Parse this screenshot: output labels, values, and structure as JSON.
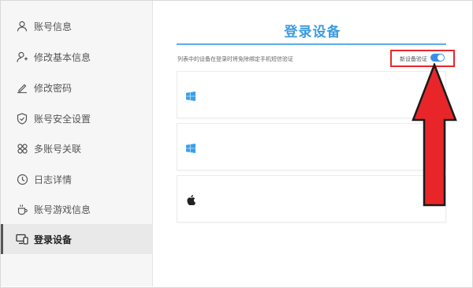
{
  "sidebar": {
    "items": [
      {
        "label": "账号信息",
        "icon": "user-icon"
      },
      {
        "label": "修改基本信息",
        "icon": "user-edit-icon"
      },
      {
        "label": "修改密码",
        "icon": "pencil-icon"
      },
      {
        "label": "账号安全设置",
        "icon": "shield-icon"
      },
      {
        "label": "多账号关联",
        "icon": "linked-accounts-icon"
      },
      {
        "label": "日志详情",
        "icon": "clock-icon"
      },
      {
        "label": "账号游戏信息",
        "icon": "cup-icon"
      },
      {
        "label": "登录设备",
        "icon": "devices-icon"
      }
    ],
    "active_index": 7
  },
  "main": {
    "title": "登录设备",
    "hint": "列表中的设备在登录时将免除绑定手机短信验证",
    "new_device_verify": {
      "label": "新设备验证",
      "enabled": true
    },
    "devices": [
      {
        "icon": "windows-icon"
      },
      {
        "icon": "windows-icon"
      },
      {
        "icon": "apple-icon"
      }
    ]
  },
  "colors": {
    "accent": "#3d9ce0",
    "toggle_on": "#3a8ee6",
    "annotation": "#e8262a"
  }
}
